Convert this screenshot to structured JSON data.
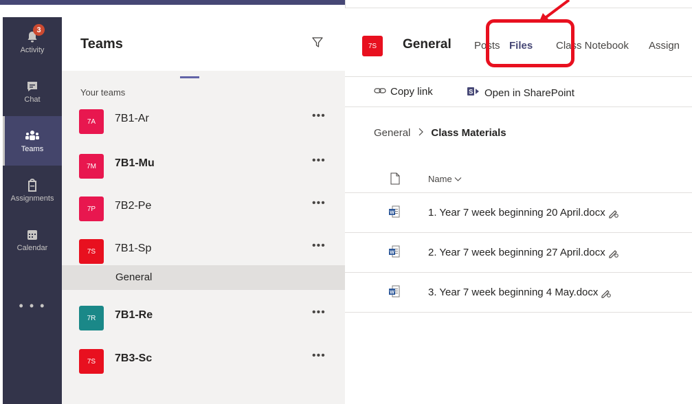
{
  "rail": {
    "items": [
      {
        "label": "Activity",
        "icon": "bell-icon",
        "badge": "3"
      },
      {
        "label": "Chat",
        "icon": "chat-icon"
      },
      {
        "label": "Teams",
        "icon": "teams-icon"
      },
      {
        "label": "Assignments",
        "icon": "assignments-icon"
      },
      {
        "label": "Calendar",
        "icon": "calendar-icon"
      }
    ],
    "more": "• • •"
  },
  "panel": {
    "title": "Teams",
    "section": "Your teams",
    "more_label": "•••",
    "teams": [
      {
        "initials": "7A",
        "name": "7B1-Ar",
        "color": "#e8174f"
      },
      {
        "initials": "7M",
        "name": "7B1-Mu",
        "color": "#e8174f"
      },
      {
        "initials": "7P",
        "name": "7B2-Pe",
        "color": "#e8174f"
      },
      {
        "initials": "7S",
        "name": "7B1-Sp",
        "color": "#e8101f"
      },
      {
        "initials": "7R",
        "name": "7B1-Re",
        "color": "#1a8888"
      },
      {
        "initials": "7S",
        "name": "7B3-Sc",
        "color": "#e8101f"
      }
    ],
    "channel": "General"
  },
  "main": {
    "initials": "7S",
    "title": "General",
    "tabs": [
      "Posts",
      "Files",
      "Class Notebook",
      "Assign"
    ],
    "toolbar": {
      "copy_link": "Copy link",
      "open_sharepoint": "Open in SharePoint"
    },
    "breadcrumb": {
      "root": "General",
      "current": "Class Materials"
    },
    "column_name": "Name",
    "files": [
      "1. Year 7 week beginning 20 April.docx",
      "2. Year 7 week beginning 27 April.docx",
      "3. Year 7 week beginning 4 May.docx"
    ]
  },
  "colors": {
    "accent": "#6264a7",
    "rail": "#33344a",
    "annotation": "#e8101f"
  }
}
